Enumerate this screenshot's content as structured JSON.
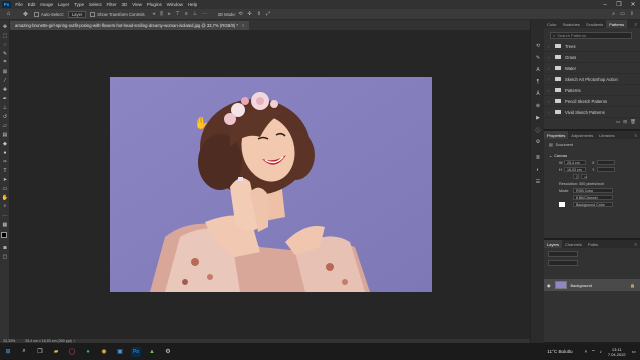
{
  "menubar": {
    "app_icon": "Ps",
    "items": [
      "File",
      "Edit",
      "Image",
      "Layer",
      "Type",
      "Select",
      "Filter",
      "3D",
      "View",
      "Plugins",
      "Window",
      "Help"
    ]
  },
  "options_bar": {
    "auto_select_label": "Auto-Select:",
    "auto_select_value": "Layer",
    "transform_label": "Show Transform Controls",
    "mode_3d": "3D Mode:"
  },
  "document_tab": {
    "title": "amazing-brunette-girl-spring-outfit-posing-with-flowers-hot-head-smiling-dreamy-woman-isolated.jpg @ 33,7% (RGB/8) *",
    "close": "×"
  },
  "status_bar": {
    "zoom": "33,33%",
    "size": "25,4 cm x 16,93 cm (300 ppi)"
  },
  "patterns_panel": {
    "tabs": [
      "Color",
      "Swatches",
      "Gradients",
      "Patterns"
    ],
    "search_placeholder": "Search Patterns",
    "folders": [
      "Trees",
      "Grass",
      "Water",
      "Sketch Art Photoshop Action",
      "Patterns",
      "Pencil Sketch Patterns",
      "Vivid Sketch Patterns"
    ]
  },
  "properties_panel": {
    "tabs": [
      "Properties",
      "Adjustments",
      "Libraries"
    ],
    "doc_label": "Document",
    "canvas_label": "Canvas",
    "w_label": "W",
    "w_value": "25,4 cm",
    "h_label": "H",
    "h_value": "16,93 cm",
    "x_label": "X",
    "y_label": "Y",
    "resolution": "Resolution: 300 pixels/inch",
    "mode_label": "Mode",
    "mode_value": "RGB Color",
    "depth_value": "8 Bit/Channel",
    "fill_label": "Background Color"
  },
  "layers_panel": {
    "tabs": [
      "Layers",
      "Channels",
      "Paths"
    ],
    "layer_name": "Background"
  },
  "taskbar": {
    "weather": "11°C Bulutlu",
    "time": "13:11",
    "date": "7.04.2022"
  }
}
